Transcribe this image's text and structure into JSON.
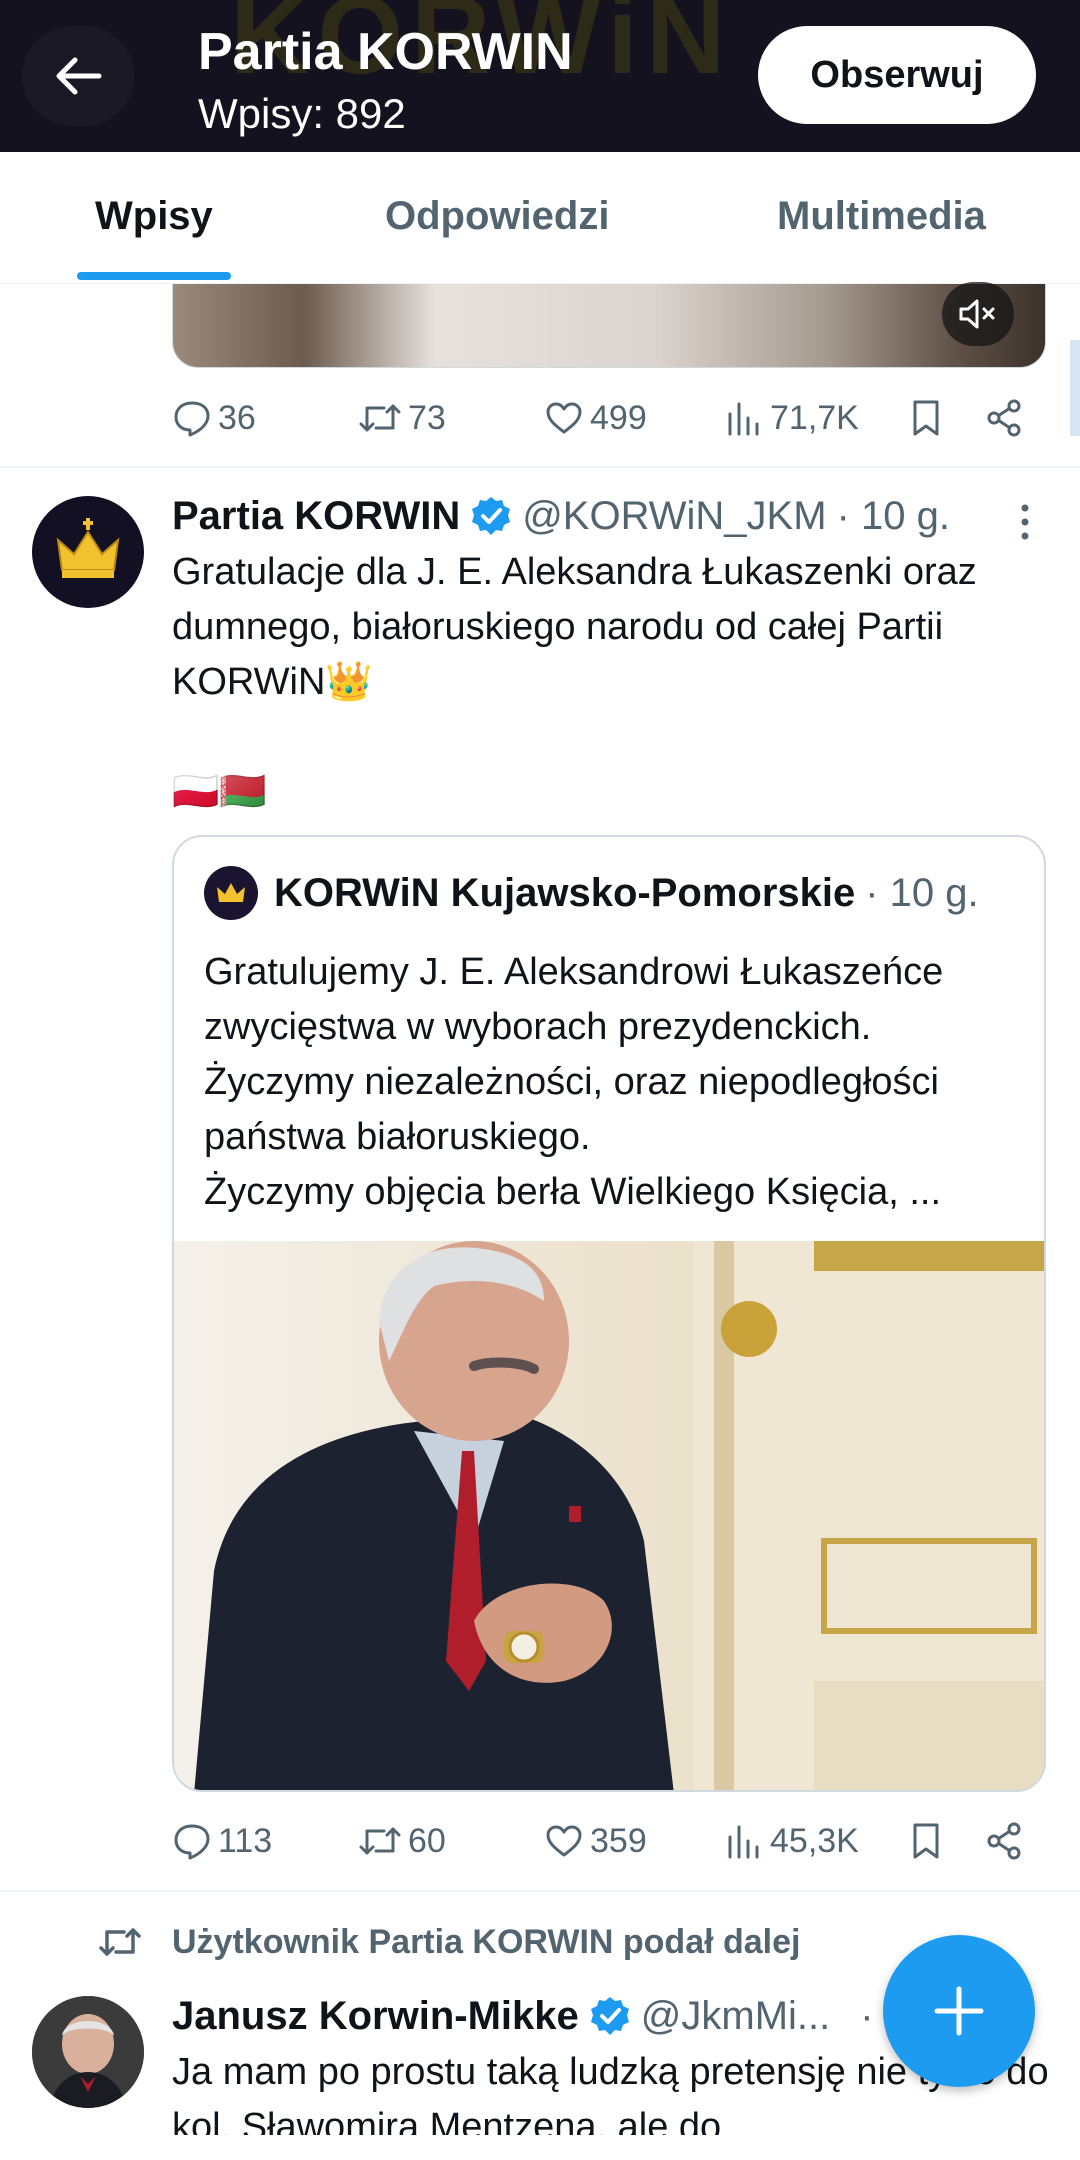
{
  "header": {
    "title": "Partia KORWIN",
    "subtitle": "Wpisy: 892",
    "follow_label": "Obserwuj"
  },
  "tabs": [
    {
      "label": "Wpisy",
      "active": true
    },
    {
      "label": "Odpowiedzi",
      "active": false
    },
    {
      "label": "Multimedia",
      "active": false
    }
  ],
  "prev_tweet": {
    "replies": "36",
    "reposts": "73",
    "likes": "499",
    "views": "71,7K"
  },
  "tweet": {
    "author": "Partia KORWIN",
    "handle": "@KORWiN_JKM",
    "time": "· 10 g.",
    "text_line1": "Gratulacje dla J. E. Aleksandra Łukaszenki oraz dumnego, białoruskiego narodu od całej Partii KORWiN👑",
    "flags": "🇵🇱🇧🇾",
    "quote": {
      "author": "KORWiN Kujawsko-Pomorskie",
      "time": "· 10 g.",
      "text": "Gratulujemy J. E. Aleksandrowi Łukaszeńce zwycięstwa w wyborach prezydenckich.",
      "text2": "Życzymy niezależności, oraz niepodległości państwa białoruskiego.",
      "text3": "Życzymy objęcia berła Wielkiego Księcia, ..."
    },
    "replies": "113",
    "reposts": "60",
    "likes": "359",
    "views": "45,3K"
  },
  "retweet_label": "Użytkownik Partia KORWIN podał dalej",
  "next_tweet": {
    "author": "Janusz Korwin-Mikke",
    "handle": "@JkmMi...",
    "time": "·",
    "text": "Ja mam po prostu taką ludzką pretensję nie tylko do kol. Sławomira Mentzena, ale do"
  },
  "colors": {
    "accent": "#1d9bf0",
    "header_bg": "#15121f",
    "muted": "#536471"
  }
}
